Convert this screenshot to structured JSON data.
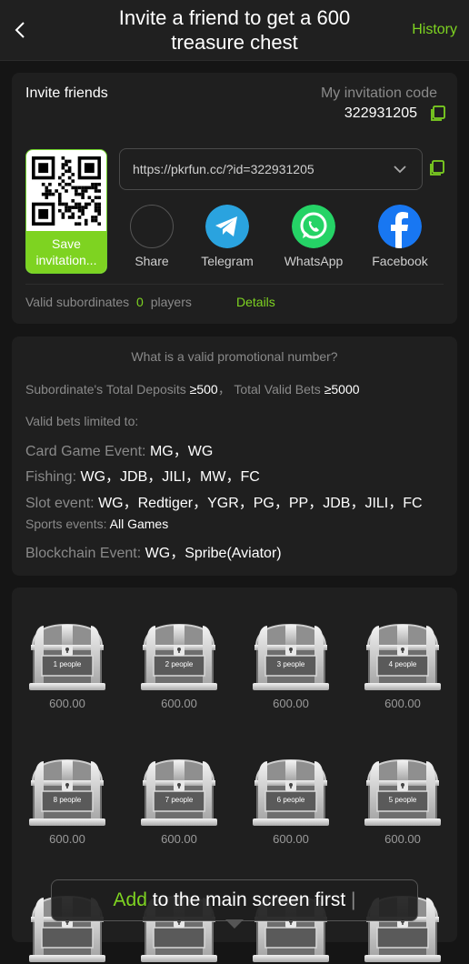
{
  "header": {
    "title": "Invite a friend to get a 600 treasure chest",
    "history_label": "History"
  },
  "invite": {
    "title": "Invite friends",
    "code_label": "My invitation code",
    "code": "322931205",
    "link": "https://pkrfun.cc/?id=322931205",
    "save_label": "Save invitation...",
    "share": [
      {
        "label": "Share",
        "icon": "share-icon"
      },
      {
        "label": "Telegram",
        "icon": "telegram-icon"
      },
      {
        "label": "WhatsApp",
        "icon": "whatsapp-icon"
      },
      {
        "label": "Facebook",
        "icon": "facebook-icon"
      }
    ],
    "valid_label": "Valid subordinates",
    "valid_count": "0",
    "valid_unit": "players",
    "details_label": "Details"
  },
  "rules": {
    "question": "What is a valid promotional number?",
    "deposits_label": "Subordinate's Total Deposits",
    "deposits_value": "≥500",
    "bets_label": "Total Valid Bets",
    "bets_value": "≥5000",
    "limited_label": "Valid bets limited to:",
    "events": [
      {
        "label": "Card Game Event:",
        "value": "MG，WG"
      },
      {
        "label": "Fishing:",
        "value": "WG，JDB，JILI，MW，FC"
      },
      {
        "label": "Slot event:",
        "value": "WG，Redtiger，YGR，PG，PP，JDB，JILI，FC"
      },
      {
        "label": "Sports events:",
        "value": "All Games"
      },
      {
        "label": "Blockchain Event:",
        "value": "WG，Spribe(Aviator)"
      }
    ]
  },
  "chests": [
    {
      "people": "1 people",
      "amount": "600.00"
    },
    {
      "people": "2 people",
      "amount": "600.00"
    },
    {
      "people": "3 people",
      "amount": "600.00"
    },
    {
      "people": "4 people",
      "amount": "600.00"
    },
    {
      "people": "8 people",
      "amount": "600.00"
    },
    {
      "people": "7 people",
      "amount": "600.00"
    },
    {
      "people": "6 people",
      "amount": "600.00"
    },
    {
      "people": "5 people",
      "amount": "600.00"
    }
  ],
  "toast": {
    "highlight": "Add",
    "rest": "to the main screen first"
  },
  "colors": {
    "accent": "#7ed321",
    "telegram": "#2aa3df",
    "whatsapp": "#25d366",
    "facebook": "#1877f2"
  }
}
